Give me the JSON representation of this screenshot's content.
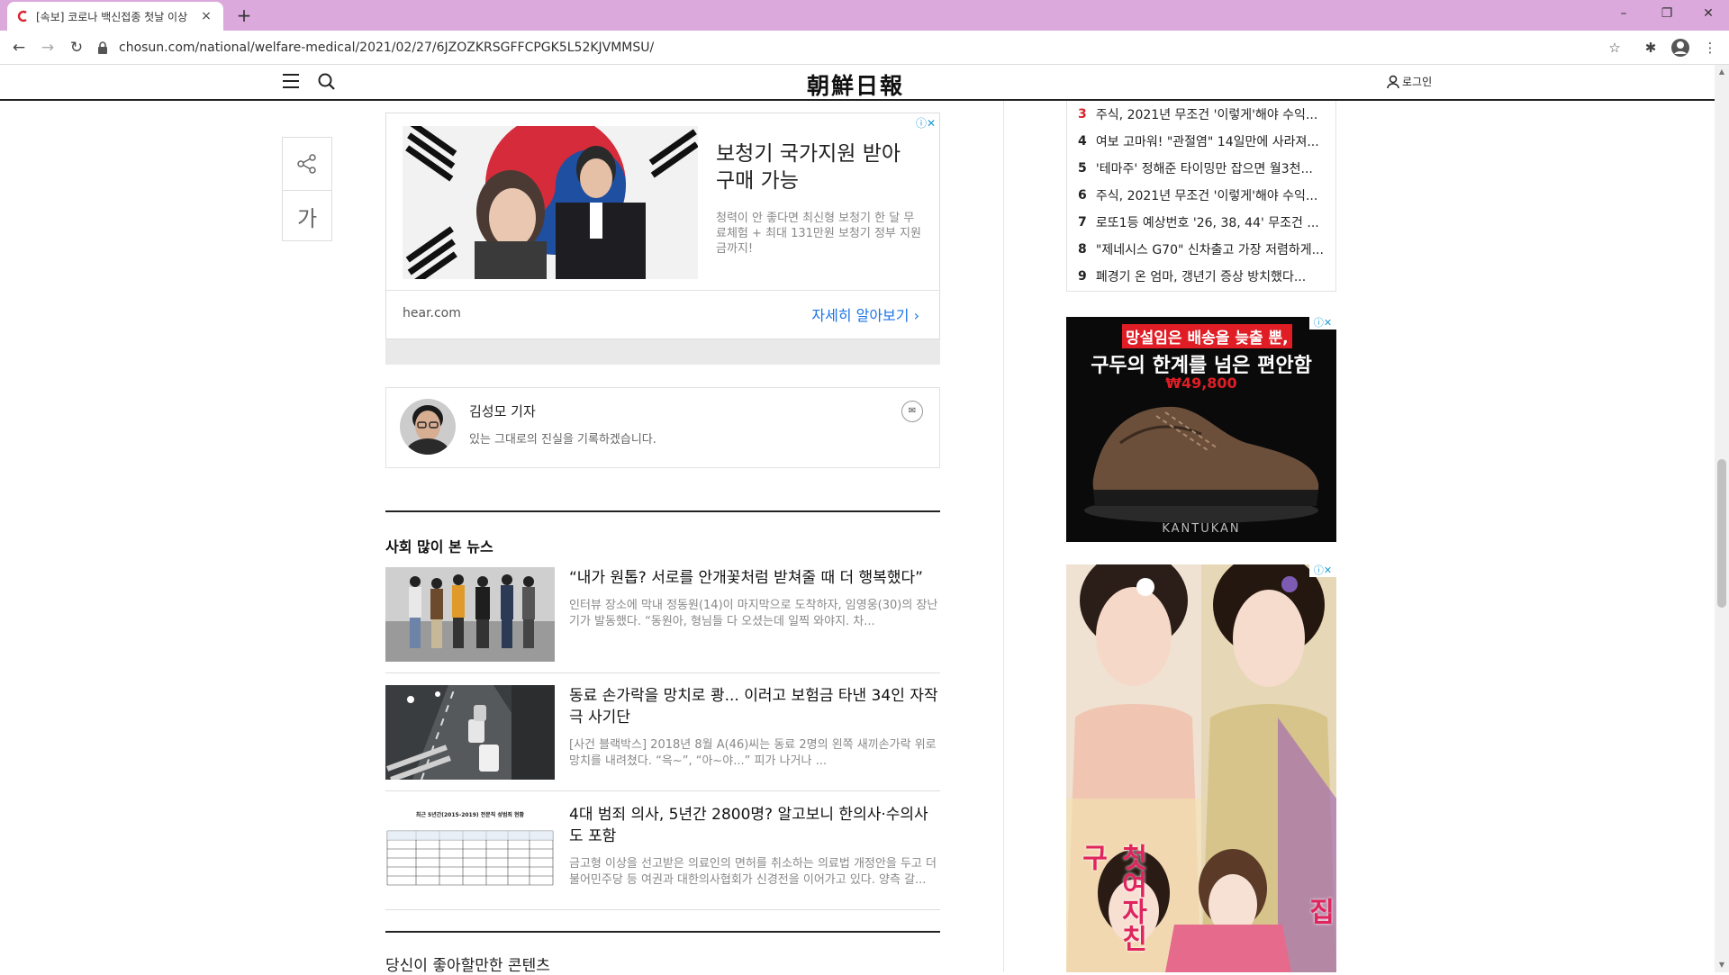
{
  "browser": {
    "tab_title": "[속보] 코로나 백신접종 첫날 이상",
    "tab_close": "×",
    "new_tab": "+",
    "url": "chosun.com/national/welfare-medical/2021/02/27/6JZOZKRSGFFCPGK5L52KJVMMSU/",
    "controls": {
      "minimize": "–",
      "restore": "❐",
      "close": "✕"
    }
  },
  "header": {
    "logo": "朝鮮日報",
    "login": "로그인"
  },
  "share": {
    "font_button": "가"
  },
  "ad": {
    "headline": "보청기 국가지원 받아 구매 가능",
    "body": "청력이 안 좋다면 최신형 보청기 한 달 무료체험 + 최대 131만원 보청기 정부 지원금까지!",
    "site": "hear.com",
    "cta": "자세히 알아보기 ›",
    "info": "ⓘ✕"
  },
  "author": {
    "name": "김성모 기자",
    "bio": "있는 그대로의 진실을 기록하겠습니다."
  },
  "popular": {
    "title": "사회 많이 본 뉴스",
    "items": [
      {
        "headline": "“내가 원톱? 서로를 안개꽃처럼 받쳐줄 때 더 행복했다”",
        "summary": "인터뷰 장소에 막내 정동원(14)이 마지막으로 도착하자, 임영웅(30)의 장난기가 발동했다. “동원아, 형님들 다 오셨는데 일찍 와야지. 차..."
      },
      {
        "headline": "동료 손가락을 망치로 쾅... 이러고 보험금 타낸 34인 자작극 사기단",
        "summary": "[사건 블랙박스] 2018년 8월 A(46)씨는 동료 2명의 왼쪽 새끼손가락 위로 망치를 내려쳤다. “윽~”, “아~야...” 피가 나거나 ..."
      },
      {
        "headline": "4대 범죄 의사, 5년간 2800명? 알고보니 한의사·수의사도 포함",
        "summary": "금고형 이상을 선고받은 의료인의 면허를 취소하는 의료법 개정안을 두고 더불어민주당 등 여권과 대한의사협회가 신경전을 이어가고 있다. 양측 갈..."
      }
    ],
    "table_caption": "최근 5년간(2015-2019) 전문직 성범죄 현황"
  },
  "next_section": "당신이 좋아할만한 콘텐츠",
  "ranking": [
    {
      "num": "3",
      "text": "주식, 2021년 무조건 '이렇게'해야 수익...",
      "hot": true
    },
    {
      "num": "4",
      "text": "여보 고마워! \"관절염\" 14일만에 사라져...",
      "hot": false
    },
    {
      "num": "5",
      "text": "'테마주' 정해준 타이밍만 잡으면 월3천...",
      "hot": false
    },
    {
      "num": "6",
      "text": "주식, 2021년 무조건 '이렇게'해야 수익...",
      "hot": false
    },
    {
      "num": "7",
      "text": "로또1등 예상번호 '26, 38, 44' 무조건 ...",
      "hot": false
    },
    {
      "num": "8",
      "text": "\"제네시스 G70\" 신차출고 가장 저렴하게...",
      "hot": false
    },
    {
      "num": "9",
      "text": "폐경기 온 엄마, 갱년기 증상 방치했다...",
      "hot": false
    }
  ],
  "shoe_ad": {
    "line1": "망설임은 배송을 늦출 뿐,",
    "line2": "구두의 한계를 넘은 편안함",
    "price": "₩49,800",
    "brand": "KANTUKAN",
    "badge": "ⓘ✕"
  },
  "game_ad": {
    "left_text": "첫여자친구",
    "right_text": "부잣집",
    "badge": "ⓘ✕"
  }
}
